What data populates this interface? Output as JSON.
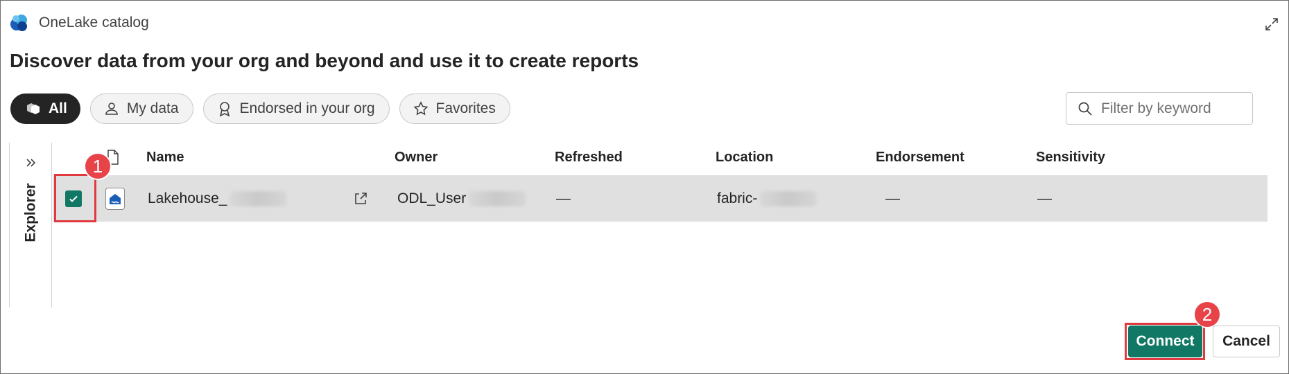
{
  "header": {
    "app_title": "OneLake catalog",
    "page_title": "Discover data from your org and beyond and use it to create reports"
  },
  "chips": [
    {
      "label": "All",
      "icon": "cube-stack-icon",
      "active": true
    },
    {
      "label": "My data",
      "icon": "person-icon",
      "active": false
    },
    {
      "label": "Endorsed in your org",
      "icon": "ribbon-icon",
      "active": false
    },
    {
      "label": "Favorites",
      "icon": "star-icon",
      "active": false
    }
  ],
  "filter": {
    "placeholder": "Filter by keyword"
  },
  "explorer": {
    "label": "Explorer"
  },
  "table": {
    "columns": [
      "Name",
      "Owner",
      "Refreshed",
      "Location",
      "Endorsement",
      "Sensitivity"
    ],
    "rows": [
      {
        "name": "Lakehouse_",
        "owner": "ODL_User",
        "refreshed": "—",
        "location": "fabric-",
        "endorsement": "—",
        "sensitivity": "—",
        "selected": true
      }
    ]
  },
  "annotations": {
    "step1": "1",
    "step2": "2"
  },
  "footer": {
    "connect_label": "Connect",
    "cancel_label": "Cancel"
  },
  "colors": {
    "accent": "#117865",
    "annotation": "#e0393e",
    "selected_row": "#e0e0e0"
  }
}
